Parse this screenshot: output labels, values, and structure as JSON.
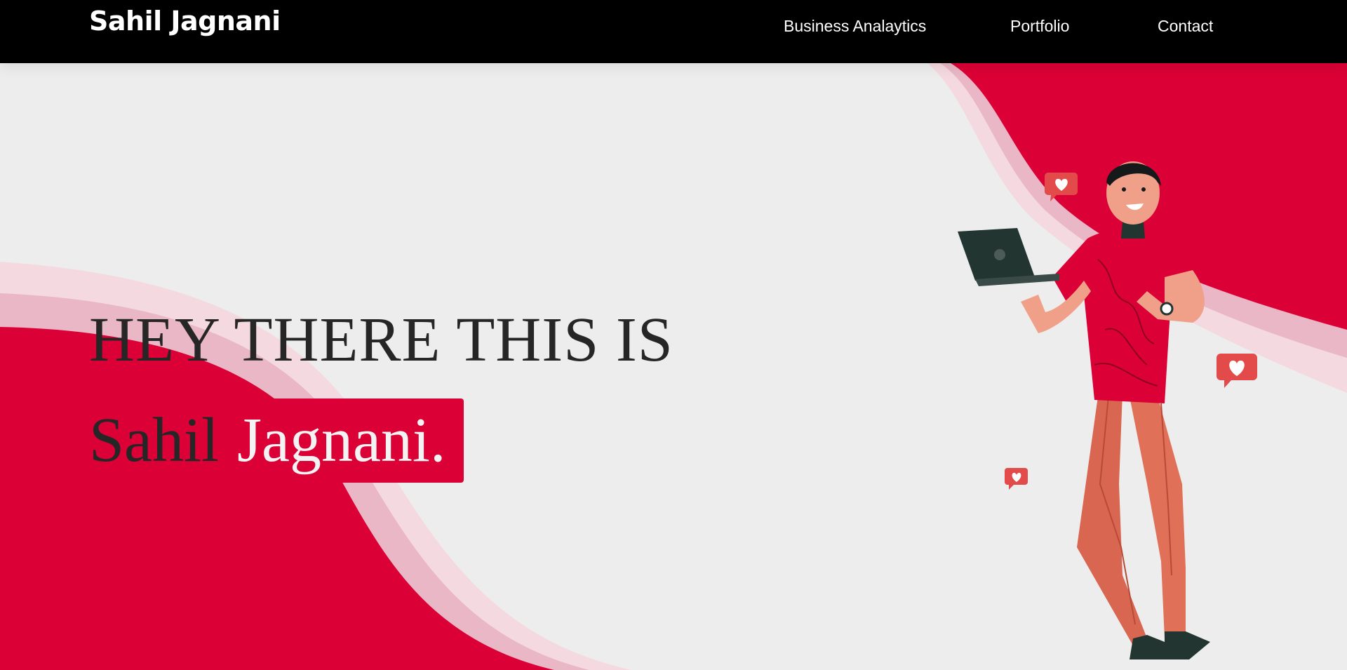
{
  "navbar": {
    "brand": "Sahil Jagnani",
    "links": [
      "Business Analaytics",
      "Portfolio",
      "Contact"
    ]
  },
  "hero": {
    "line1": "HEY THERE THIS IS",
    "name_first": "Sahil",
    "name_last": "Jagnani."
  },
  "colors": {
    "accent": "#db0035",
    "navbar_bg": "#000000",
    "page_bg": "#ededed",
    "text_dark": "#262626"
  },
  "icons": [
    "heart-bubble-icon",
    "laptop-icon",
    "watch-icon"
  ]
}
